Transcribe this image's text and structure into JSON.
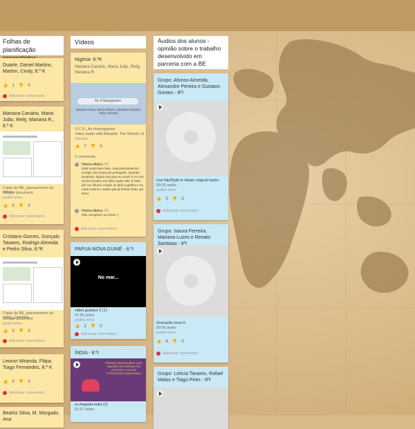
{
  "columns": [
    {
      "title": "Folhas de planificação\npreenchidas"
    },
    {
      "title": "Vídeos"
    },
    {
      "title": "Áudios dos alunos - opinião sobre o trabalho desenvolvido em parceria com a BE"
    }
  ],
  "col1": {
    "card1": {
      "title": "Duarte, Daniel Martins, Martim, Cindy, 8.º K",
      "likes": "1",
      "dislikes": "0",
      "comment": "Adicionar comentário"
    },
    "card2": {
      "title": "Mariana Canário, Maria João, Reily, Mariana R., 8.º K",
      "file": "Cópia de BE_planeamento do vídeo",
      "kind": "Google document",
      "source": "padlet drive",
      "likes": "0",
      "dislikes": "0",
      "comment": "Adicionar comentário"
    },
    "card3": {
      "title": "Cristiano Gomes, Gonçalo Tavares, Rodrigo Almeida e Pedro Silva, 8.ºK",
      "file": "Cópia de BE_planeamento do vídeo_Cristiano",
      "kind": "Google document",
      "source": "padlet drive",
      "likes": "0",
      "dislikes": "0",
      "comment": "Adicionar comentário"
    },
    "card4": {
      "title": "Leonor Miranda, Filipa, Tiago Fernandes, 8.º K",
      "likes": "0",
      "dislikes": "0",
      "comment": "Adicionar comentário"
    },
    "card5": {
      "title": "Beatriz Silva, M. Morgado, Ana"
    }
  },
  "col2": {
    "card1": {
      "title": "Nigéria- 8.ºK",
      "authors": "Mariana Canário, Maria João, Reily, Mariana R.",
      "thumb_title": "As 4 Navegantes",
      "thumb_names": "Mariana Rosa, Maria Ribeiro, Mariana Canário, Reily Ferreira",
      "file": "O.C.P._As 4navegantes",
      "desc": "Video made with Biteable, The World's Si...",
      "source": "biteable",
      "likes": "7",
      "dislikes": "0",
      "comments_count": "2 comments",
      "c1_author": "Helena Alelus",
      "c1_time": "2M",
      "c1_text": "Está muito bem feito, mas precisávamos corrigir uns erritos de português. Quando puderem, digam-me para eu reunir 5 m com vocês só para vos dizer quais são. É feita pôr na coluna o áudio ao lado a grelha e na outra coluna o áudio que já tinham feito, por favor.",
      "c2_author": "Helena Alelus",
      "c2_time": "2M",
      "c2_text": "Não corrigiram os erros! :(",
      "add_comment": "Adicionar comentário"
    },
    "card2": {
      "title": "PAPUA-NOVA GUINÉ - 8.ºI",
      "video_text": "No mar...",
      "file": "video gustavo 2 (1)",
      "dur": "01:55 video",
      "source": "padlet drive",
      "likes": "3",
      "dislikes": "0",
      "comment": "Adicionar comentário"
    },
    "card3": {
      "title": "ÍNDIA - 8.ºI",
      "video_text": "FERNÃO MAGALHÃES: QUE NAÇÕES ESTIVERAM EM CONTATO COM AS EXPEDIÇÕES MARÍTIMAS",
      "file": "a-chegada-india (1)",
      "dur": "01:27 video",
      "source": "01:27 video"
    }
  },
  "col3": {
    "card1": {
      "title": "Grupo: Afonso Almeida, Alexandre Pereira e Gustavo Gomes - 8ºI",
      "file": "Use Mp3Split to obtain original tracks",
      "dur": "00:06 audio",
      "source": "padlet drive",
      "likes": "3",
      "dislikes": "0",
      "comment": "Adicionar comentário"
    },
    "card2": {
      "title": "Grupo: Isaura Ferreira, Mariana Luzes e Renato Santiago - 8ºI",
      "file": "Gravação nova 5",
      "dur": "00:36 audio",
      "source": "padlet drive",
      "likes": "4",
      "dislikes": "0",
      "comment": "Adicionar comentário"
    },
    "card3": {
      "title": "Grupo: Letícia Tavares, Rafael Matos e Tiago Pires - 8ºI"
    }
  },
  "colors": {
    "yellow": "#fde7a6",
    "blue": "#c9e9f7",
    "map": "#d8b888"
  }
}
